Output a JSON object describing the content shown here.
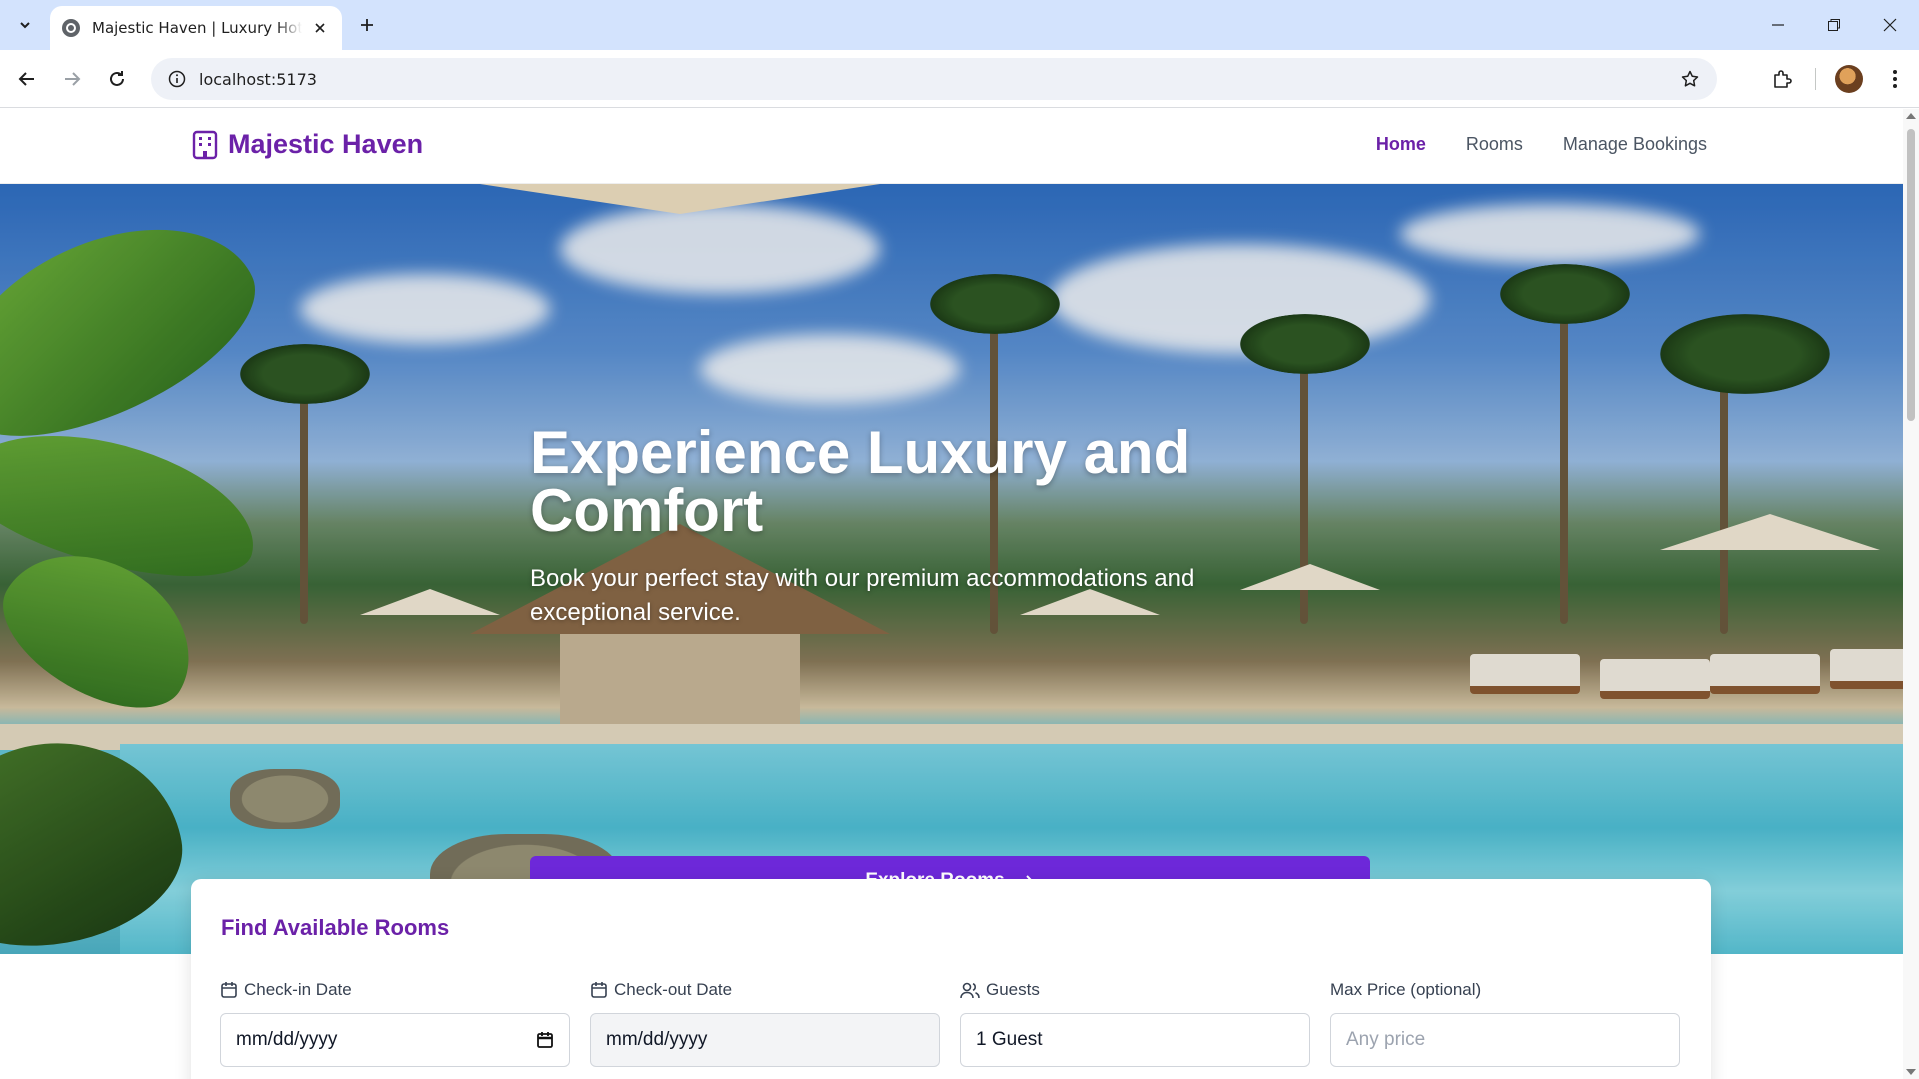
{
  "browser": {
    "tab_title": "Majestic Haven | Luxury Hotel & Resort",
    "url": "localhost:5173"
  },
  "site": {
    "brand": "Majestic Haven",
    "nav": [
      {
        "label": "Home",
        "active": true
      },
      {
        "label": "Rooms",
        "active": false
      },
      {
        "label": "Manage Bookings",
        "active": false
      }
    ]
  },
  "hero": {
    "title": "Experience Luxury and Comfort",
    "subtitle": "Book your perfect stay with our premium accommodations and exceptional service.",
    "cta_label": "Explore Rooms"
  },
  "search": {
    "title": "Find Available Rooms",
    "checkin": {
      "label": "Check-in Date",
      "value": "mm/dd/yyyy"
    },
    "checkout": {
      "label": "Check-out Date",
      "value": "mm/dd/yyyy"
    },
    "guests": {
      "label": "Guests",
      "value": "1 Guest"
    },
    "max_price": {
      "label": "Max Price (optional)",
      "placeholder": "Any price"
    }
  },
  "colors": {
    "brand": "#6b21a8",
    "button": "#6d28d9",
    "tabstrip": "#d3e3fd"
  }
}
